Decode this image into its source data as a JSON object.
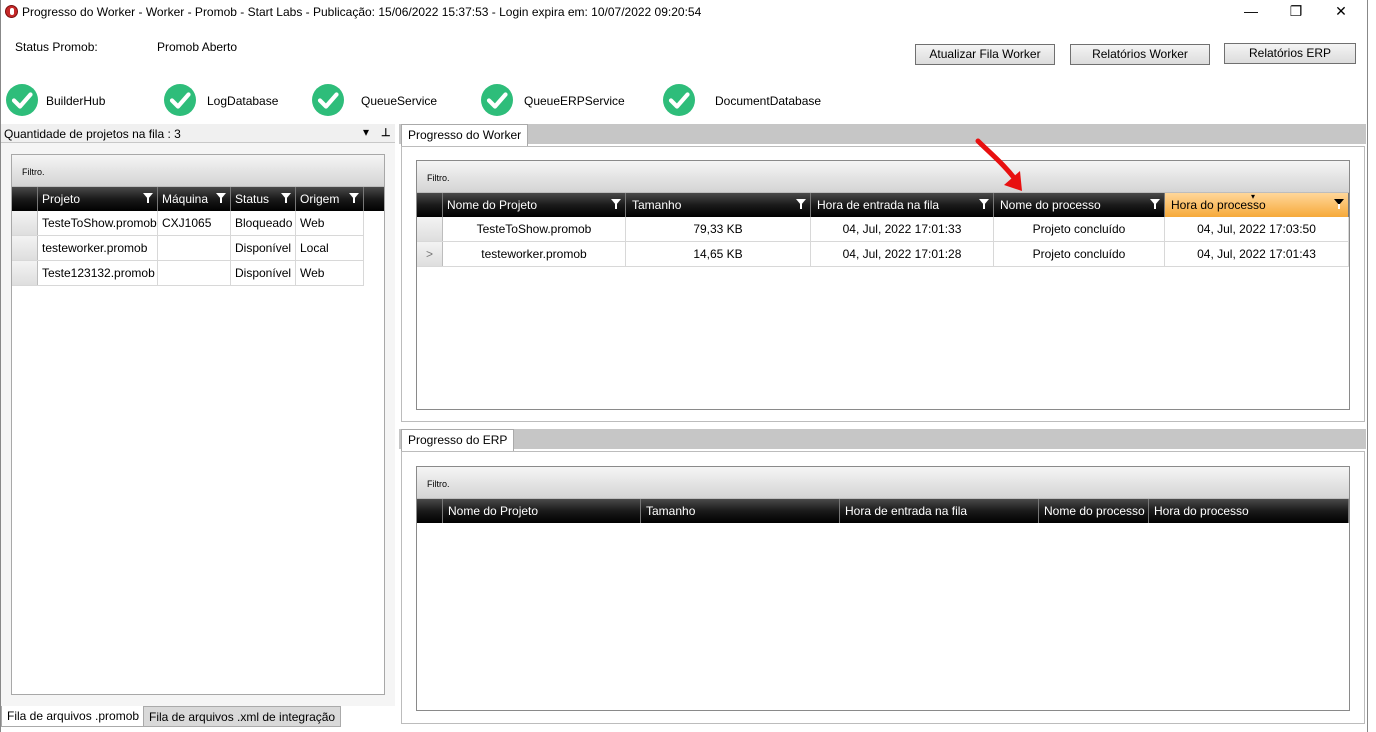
{
  "window": {
    "title": "Progresso do Worker  -  Worker - Promob  -  Start Labs  -  Publicação: 15/06/2022 15:37:53  -  Login expira em: 10/07/2022 09:20:54",
    "minimize": "—",
    "restore": "❐",
    "close": "✕"
  },
  "status": {
    "label": "Status Promob:",
    "value": "Promob Aberto"
  },
  "toolbar": {
    "refresh_label": "Atualizar Fila Worker",
    "worker_reports_label": "Relatórios Worker",
    "erp_reports_label": "Relatórios ERP"
  },
  "services": [
    {
      "name": "BuilderHub",
      "icon": "check-circle-icon"
    },
    {
      "name": "LogDatabase",
      "icon": "check-circle-icon"
    },
    {
      "name": "QueueService",
      "icon": "check-circle-icon"
    },
    {
      "name": "QueueERPService",
      "icon": "check-circle-icon"
    },
    {
      "name": "DocumentDatabase",
      "icon": "check-circle-icon"
    }
  ],
  "colors": {
    "service_ok": "#2ebd7a",
    "highlight_header": "#f6a93a",
    "arrow": "#e81010"
  },
  "left_panel": {
    "title": "Quantidade de projetos na fila : 3",
    "dropdown_glyph": "▾",
    "pin_glyph": "⊥",
    "filter_label": "Filtro.",
    "columns": [
      "Projeto",
      "Máquina",
      "Status",
      "Origem"
    ],
    "rows": [
      {
        "projeto": "TesteToShow.promob",
        "maquina": "CXJ1065",
        "status": "Bloqueado",
        "origem": "Web"
      },
      {
        "projeto": "testeworker.promob",
        "maquina": "",
        "status": "Disponível",
        "origem": "Local"
      },
      {
        "projeto": "Teste123132.promob",
        "maquina": "",
        "status": "Disponível",
        "origem": "Web"
      }
    ],
    "tabs": [
      "Fila de arquivos .promob",
      "Fila de arquivos .xml de integração"
    ]
  },
  "worker_progress": {
    "tab_label": "Progresso do Worker",
    "filter_label": "Filtro.",
    "sort_glyph": "▾",
    "columns": [
      "Nome do Projeto",
      "Tamanho",
      "Hora de entrada na fila",
      "Nome do processo",
      "Hora do processo"
    ],
    "row_indicator": ">",
    "rows": [
      {
        "projeto": "TesteToShow.promob",
        "tamanho": "79,33 KB",
        "entrada": "04, Jul, 2022 17:01:33",
        "processo": "Projeto  concluído",
        "hora": "04, Jul, 2022 17:03:50"
      },
      {
        "projeto": "testeworker.promob",
        "tamanho": "14,65 KB",
        "entrada": "04, Jul, 2022 17:01:28",
        "processo": "Projeto  concluído",
        "hora": "04, Jul, 2022 17:01:43"
      }
    ]
  },
  "erp_progress": {
    "tab_label": "Progresso do ERP",
    "filter_label": "Filtro.",
    "columns": [
      "Nome do Projeto",
      "Tamanho",
      "Hora de entrada na fila",
      "Nome do processo",
      "Hora do processo"
    ]
  }
}
